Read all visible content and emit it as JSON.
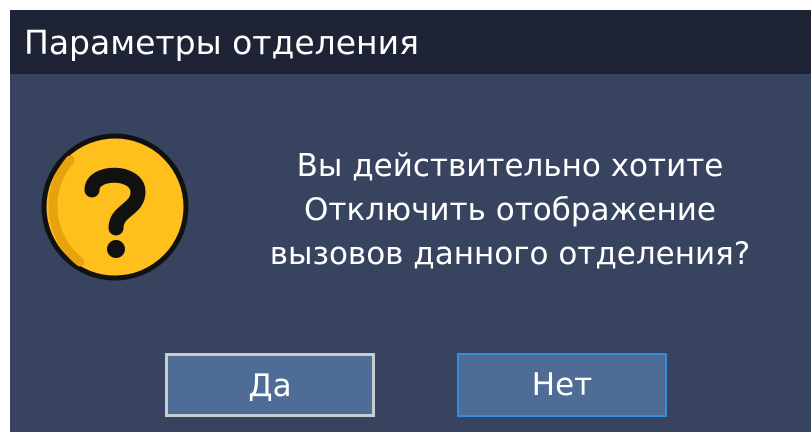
{
  "dialog": {
    "title": "Параметры отделения",
    "icon": "question-mark-icon",
    "message_lines": [
      "Вы действительно хотите",
      "Отключить отображение",
      "вызовов данного отделения?"
    ],
    "buttons": {
      "yes_label": "Да",
      "no_label": "Нет"
    }
  },
  "colors": {
    "dialog_background": "#37435f",
    "titlebar_background": "#1e2436",
    "button_background": "#4f6c96",
    "icon_fill": "#ffc01e",
    "focus_border": "#2f8fdc"
  }
}
